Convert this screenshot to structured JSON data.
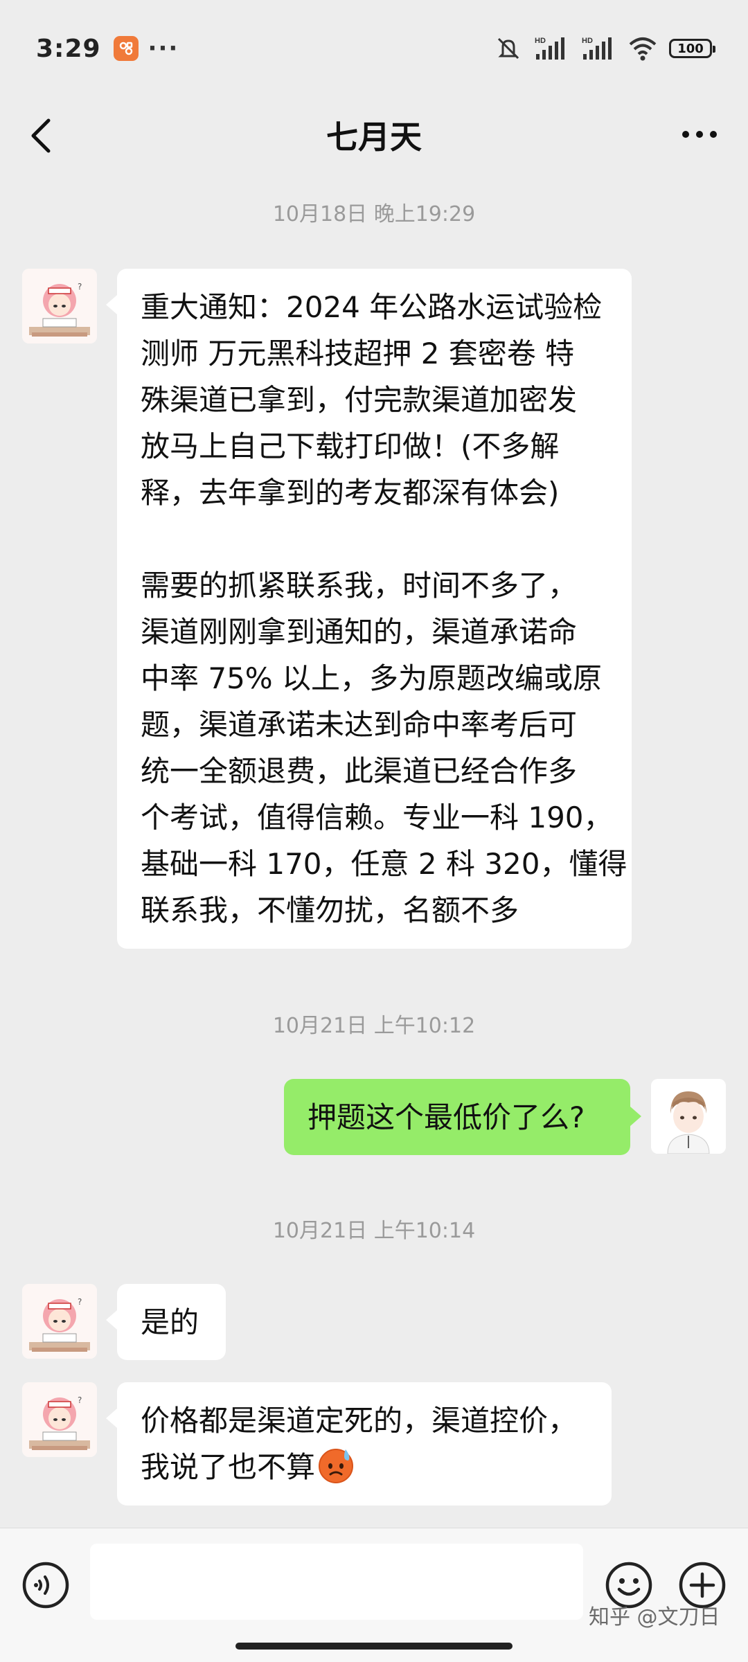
{
  "status_bar": {
    "time": "3:29",
    "more": "···",
    "battery": "100",
    "icons": [
      "app-notification-icon",
      "mute-icon",
      "signal-hd-icon",
      "signal-hd-icon",
      "wifi-icon",
      "battery-icon"
    ]
  },
  "header": {
    "title": "七月天"
  },
  "chat": {
    "timestamps": [
      "10月18日 晚上19:29",
      "10月21日 上午10:12",
      "10月21日 上午10:14"
    ],
    "messages": [
      {
        "sender": "contact",
        "paragraphs": [
          [
            "重大通知：2024 年公路水运试验检",
            "测师  万元黑科技超押 2 套密卷 特",
            "殊渠道已拿到，付完款渠道加密发",
            "放马上自己下载打印做！(不多解",
            "释，去年拿到的考友都深有体会)"
          ],
          [
            "需要的抓紧联系我，时间不多了，",
            "渠道刚刚拿到通知的，渠道承诺命",
            "中率 75% 以上，多为原题改编或原",
            "题，渠道承诺未达到命中率考后可",
            "统一全额退费，此渠道已经合作多",
            "个考试，值得信赖。专业一科 190，",
            "基础一科 170，任意 2 科 320，懂得",
            "联系我，不懂勿扰，名额不多"
          ]
        ]
      },
      {
        "sender": "me",
        "text": "押题这个最低价了么?"
      },
      {
        "sender": "contact",
        "text": "是的"
      },
      {
        "sender": "contact",
        "lines": [
          "价格都是渠道定死的，渠道控价，",
          "我说了也不算"
        ],
        "emoji": "sweat-face-emoji"
      }
    ]
  },
  "input": {
    "placeholder": ""
  },
  "watermark": "知乎 @文刀日"
}
